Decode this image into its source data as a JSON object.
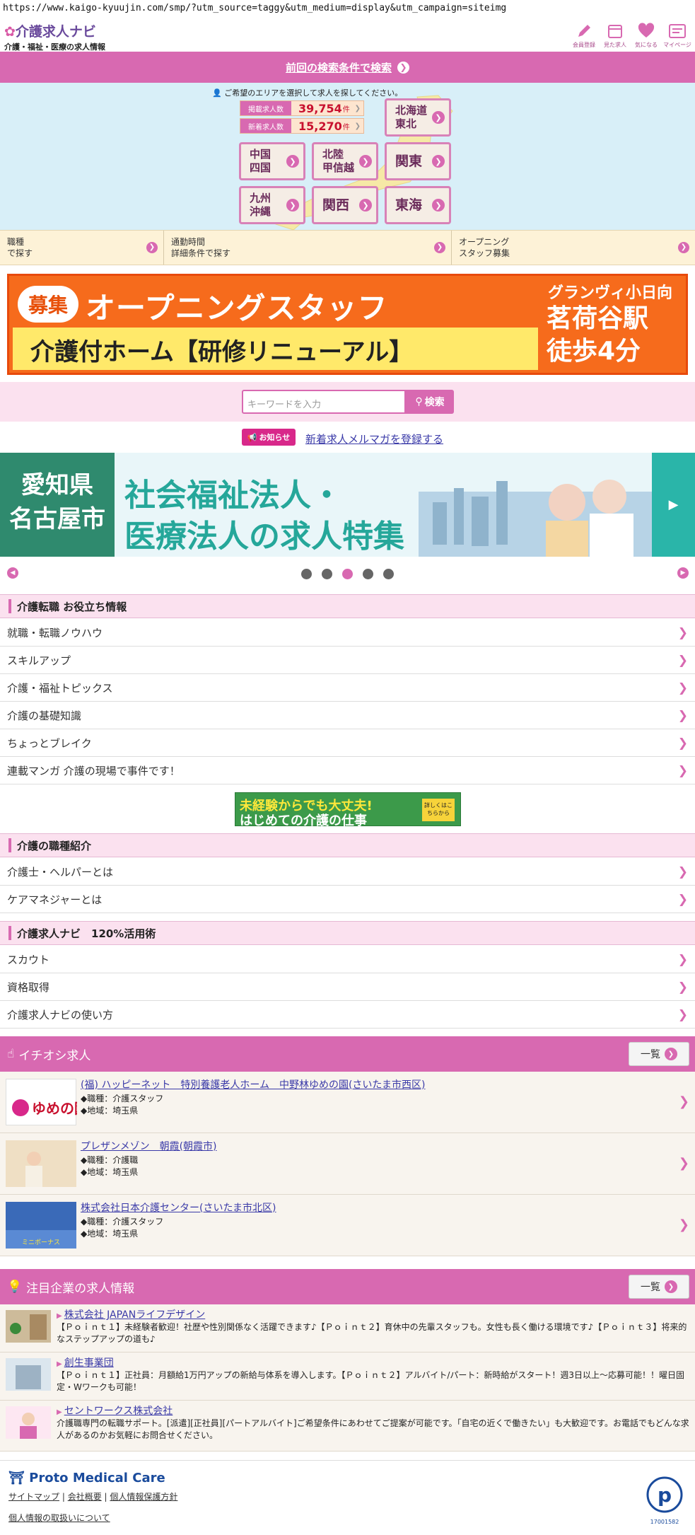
{
  "url": "https://www.kaigo-kyuujin.com/smp/?utm_source=taggy&utm_medium=display&utm_campaign=siteimg",
  "header": {
    "logo_title": "介護求人ナビ",
    "logo_sub": "介護・福祉・医療の求人情報",
    "icons": [
      {
        "label": "会員登録",
        "icon": "pencil-icon"
      },
      {
        "label": "見た求人",
        "icon": "calendar-icon"
      },
      {
        "label": "気になる",
        "icon": "heart-icon"
      },
      {
        "label": "マイページ",
        "icon": "profile-icon"
      }
    ]
  },
  "last_search": "前回の検索条件で検索",
  "map": {
    "hint": "ご希望のエリアを選択して求人を探してください。",
    "published_label": "掲載求人数",
    "published_count": "39,754",
    "new_label": "新着求人数",
    "new_count": "15,270",
    "unit": "件",
    "regions": {
      "hokkaido": "北海道\n東北",
      "chugoku": "中国\n四国",
      "hokuriku": "北陸\n甲信越",
      "kanto": "関東",
      "kyushu": "九州\n沖縄",
      "kansai": "関西",
      "tokai": "東海"
    }
  },
  "search_options": [
    "職種\nで探す",
    "通勤時間\n詳細条件で探す",
    "オープニング\nスタッフ募集"
  ],
  "banner1": {
    "badge": "募集",
    "title": "オープニングスタッフ",
    "subtitle": "介護付ホーム【研修リニューアル】",
    "right1": "グランヴィ小日向",
    "right2": "茗荷谷駅\n徒歩4分"
  },
  "keyword": {
    "placeholder": "キーワードを入力",
    "button": "検索"
  },
  "notice": {
    "badge": "お知らせ",
    "link": "新着求人メルマガを登録する"
  },
  "banner2": {
    "left": "愛知県\n名古屋市",
    "title1": "社会福祉法人・",
    "title2": "医療法人の求人特集"
  },
  "slider": {
    "dots": 5,
    "active": 3
  },
  "sections": {
    "tips": {
      "title": "介護転職 お役立ち情報",
      "items": [
        "就職・転職ノウハウ",
        "スキルアップ",
        "介護・福祉トピックス",
        "介護の基礎知識",
        "ちょっとブレイク",
        "連載マンガ 介護の現場で事件です！"
      ]
    },
    "jobs_intro": {
      "title": "介護の職種紹介",
      "items": [
        "介護士・ヘルパーとは",
        "ケアマネジャーとは"
      ]
    },
    "usage": {
      "title": "介護求人ナビ　120%活用術",
      "items": [
        "スカウト",
        "資格取得",
        "介護求人ナビの使い方"
      ]
    }
  },
  "banner3": {
    "line1": "未経験からでも大丈夫!",
    "line2": "はじめての介護の仕事",
    "side": "詳しくはこちらから"
  },
  "pickup": {
    "title": "イチオシ求人",
    "list_label": "一覧",
    "jobs": [
      {
        "name": "(福) ハッピーネット　特別養護老人ホーム　中野林ゆめの園(さいたま市西区)",
        "type": "◆職種：介護スタッフ",
        "area": "◆地域：埼玉県",
        "thumb": "ゆめの園"
      },
      {
        "name": "プレザンメゾン　朝霞(朝霞市)",
        "type": "◆職種：介護職",
        "area": "◆地域：埼玉県",
        "thumb": ""
      },
      {
        "name": "株式会社日本介護センター(さいたま市北区)",
        "type": "◆職種：介護スタッフ",
        "area": "◆地域：埼玉県",
        "thumb": "ミニボーナス"
      }
    ]
  },
  "featured": {
    "title": "注目企業の求人情報",
    "list_label": "一覧",
    "companies": [
      {
        "name": "株式会社 JAPANライフデザイン",
        "desc": "【Ｐｏｉｎｔ１】未経験者歓迎！社歴や性別関係なく活躍できます♪【Ｐｏｉｎｔ２】育休中の先輩スタッフも。女性も長く働ける環境です♪【Ｐｏｉｎｔ３】将来的なステップアップの道も♪"
      },
      {
        "name": "創生事業団",
        "desc": "【Ｐｏｉｎｔ１】正社員：月額給1万円アップの新給与体系を導入します。【Ｐｏｉｎｔ２】アルバイト/パート：新時給がスタート！週3日以上〜応募可能！！曜日固定・Wワークも可能！"
      },
      {
        "name": "セントワークス株式会社",
        "desc": "介護職専門の転職サポート。[派遣][正社員][パートアルバイト]ご希望条件にあわせてご提案が可能です。「自宅の近くで働きたい」も大歓迎です。お電話でもどんな求人があるのかお気軽にお問合せください。"
      }
    ]
  },
  "footer": {
    "brand": "Proto Medical Care",
    "links": [
      "サイトマップ",
      "会社概要",
      "個人情報保護方針"
    ],
    "privacy_link": "個人情報の取扱いについて",
    "privacy_mark": "17001582"
  }
}
